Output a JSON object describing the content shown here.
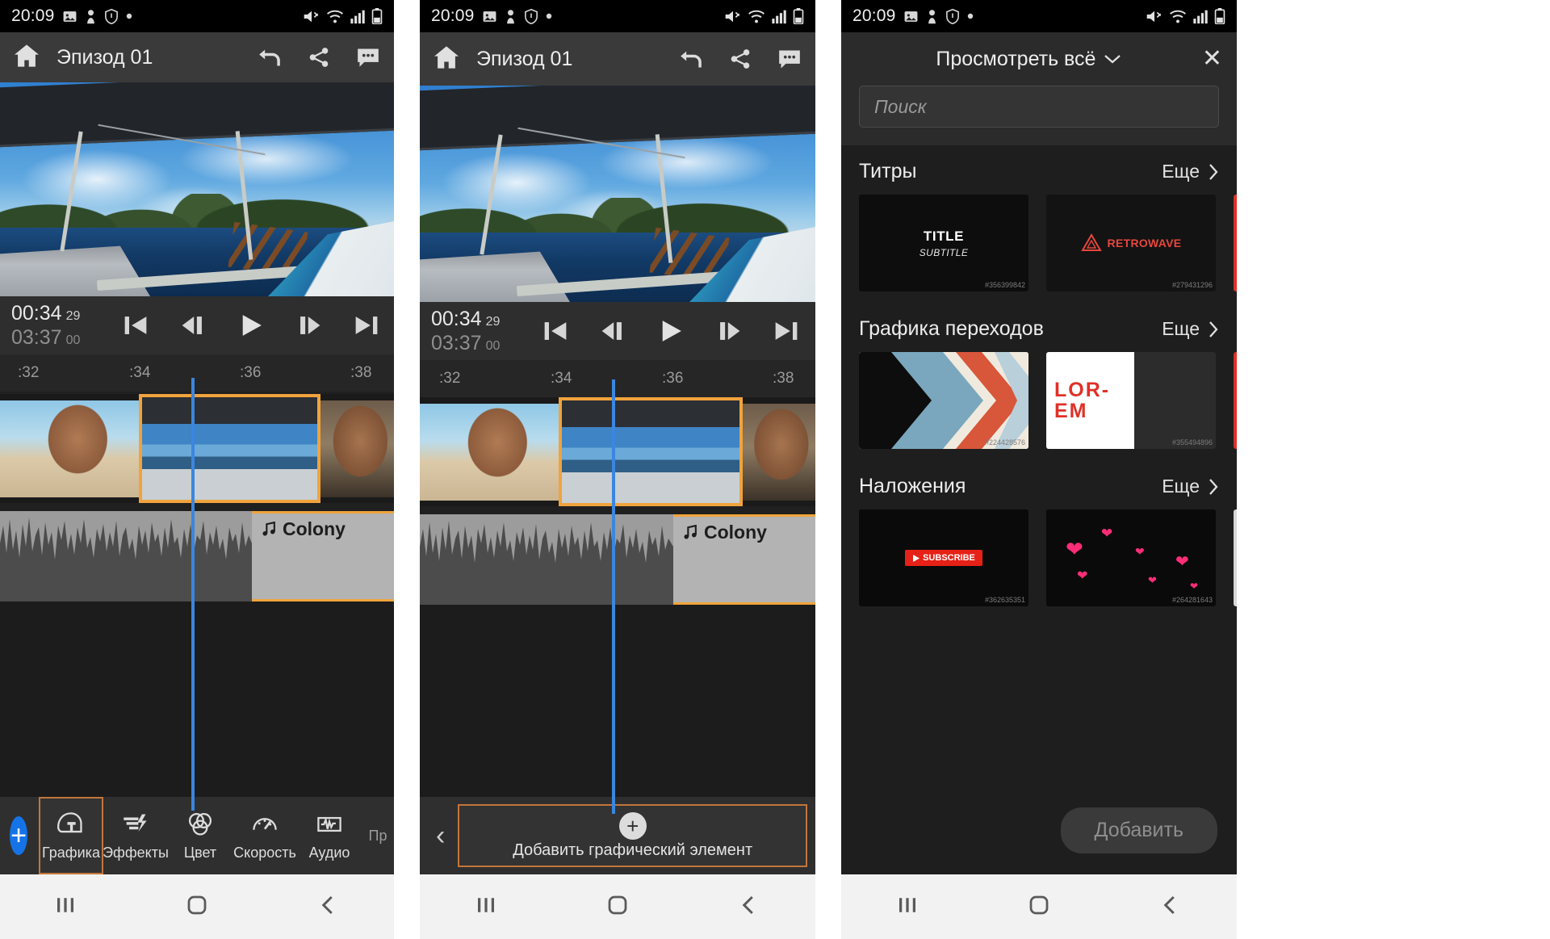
{
  "status_bar": {
    "time": "20:09",
    "icons": [
      "image-icon",
      "person-icon",
      "shield-icon",
      "dot-icon"
    ],
    "right_icons": [
      "mute-icon",
      "wifi-icon",
      "signal-icon",
      "battery-icon"
    ]
  },
  "editor": {
    "header": {
      "home_icon": "home-icon",
      "title": "Эпизод 01",
      "undo_icon": "undo-icon",
      "share_icon": "share-icon",
      "comment_icon": "comment-icon"
    },
    "transport": {
      "current_time": "00:34",
      "current_frames": "29",
      "total_time": "03:37",
      "total_frames": "00",
      "buttons": [
        "skip-start-icon",
        "step-back-icon",
        "play-icon",
        "step-forward-icon",
        "skip-end-icon"
      ]
    },
    "ruler": {
      "ticks": [
        ":32",
        ":34",
        ":36",
        ":38"
      ]
    },
    "audio_clip_label": "Colony",
    "toolbar": {
      "add_label": "+",
      "tools": [
        {
          "label": "Графика",
          "icon": "graphics-icon",
          "active": true
        },
        {
          "label": "Эффекты",
          "icon": "effects-icon",
          "active": false
        },
        {
          "label": "Цвет",
          "icon": "color-icon",
          "active": false
        },
        {
          "label": "Скорость",
          "icon": "speed-icon",
          "active": false
        },
        {
          "label": "Аудио",
          "icon": "audio-icon",
          "active": false
        },
        {
          "label": "Пр",
          "icon": "more-icon",
          "active": false
        }
      ]
    },
    "graphics_bar": {
      "back_icon": "chevron-left-icon",
      "plus_icon": "plus-icon",
      "label": "Добавить графический элемент"
    }
  },
  "browser": {
    "header": {
      "title": "Просмотреть всё",
      "chevron": "chevron-down-icon",
      "close_icon": "close-icon"
    },
    "search": {
      "placeholder": "Поиск",
      "value": ""
    },
    "more_label": "Еще",
    "sections": [
      {
        "title": "Титры",
        "items": [
          {
            "kind": "title-card",
            "line1": "TITLE",
            "line2": "SUBTITLE",
            "id": "#356399842"
          },
          {
            "kind": "retrowave-card",
            "line1": "RETROWAVE",
            "id": "#279431296"
          },
          {
            "kind": "red-card",
            "line1": "",
            "id": ""
          }
        ]
      },
      {
        "title": "Графика переходов",
        "items": [
          {
            "kind": "arrow-card",
            "line1": "",
            "id": "#224428576"
          },
          {
            "kind": "lorem-card",
            "line1": "LOR-",
            "line2": "EM",
            "id": "#355494896"
          },
          {
            "kind": "red-card",
            "line1": "",
            "id": ""
          }
        ]
      },
      {
        "title": "Наложения",
        "items": [
          {
            "kind": "subscribe-card",
            "line1": "SUBSCRIBE",
            "id": "#362635351"
          },
          {
            "kind": "hearts-card",
            "line1": "",
            "id": "#264281643"
          },
          {
            "kind": "blank-card",
            "line1": "",
            "id": ""
          }
        ]
      }
    ],
    "footer": {
      "add_label": "Добавить"
    }
  },
  "nav": {
    "recent_icon": "recents-icon",
    "home_icon": "home-square-icon",
    "back_icon": "back-chevron-icon"
  },
  "colors": {
    "accent_blue": "#1473e6",
    "playhead": "#3b86e0",
    "selection": "#f0a33c",
    "tool_active": "#c3763a"
  }
}
